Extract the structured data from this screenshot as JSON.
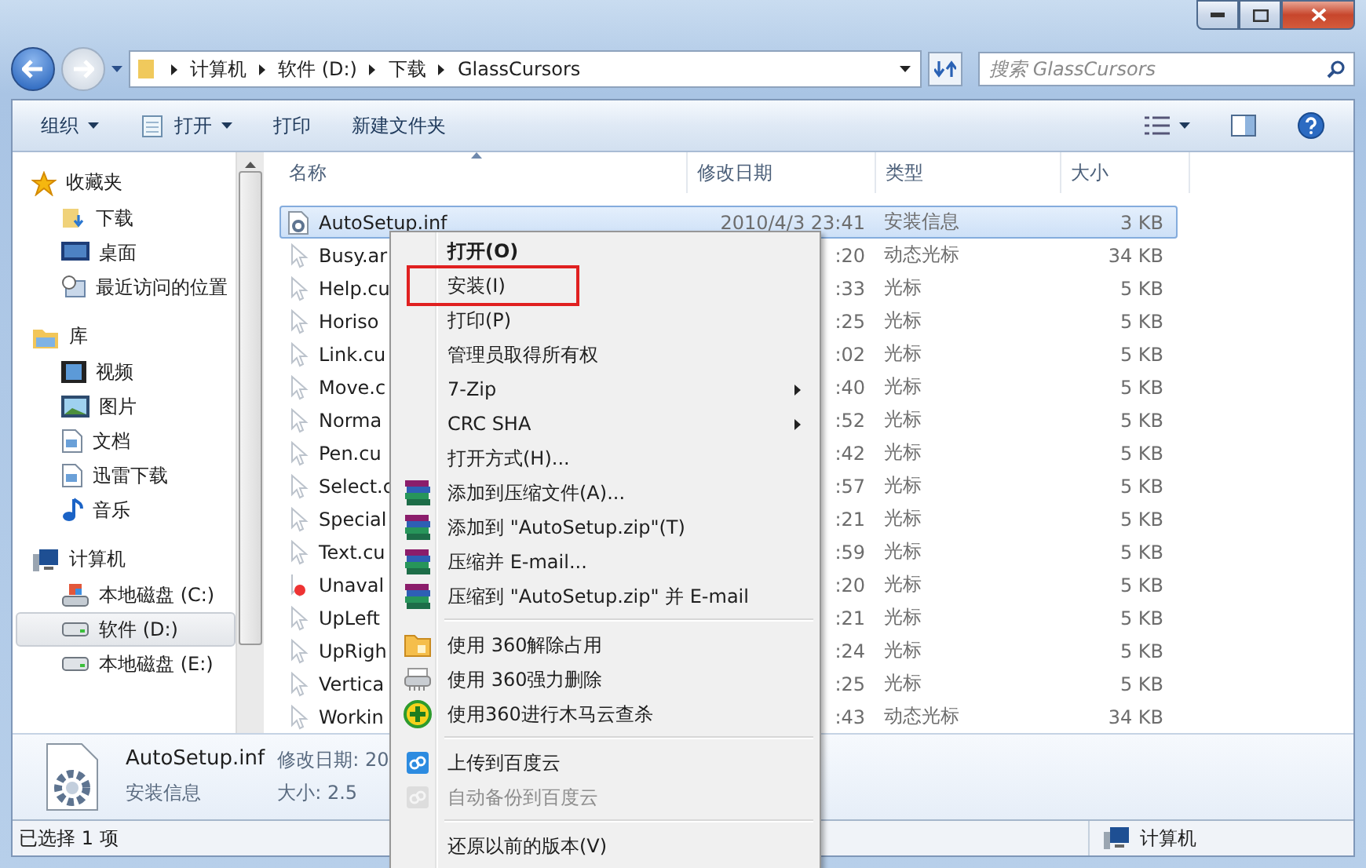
{
  "nav": {
    "path": [
      "计算机",
      "软件 (D:)",
      "下载",
      "GlassCursors"
    ],
    "search": {
      "placeholder": "搜索 GlassCursors"
    }
  },
  "toolbar": {
    "buttons": [
      {
        "label": "组织",
        "kind": "plain",
        "dropdown": true
      },
      {
        "label": "打开",
        "kind": "notepad",
        "dropdown": true
      },
      {
        "label": "打印",
        "kind": "plain",
        "dropdown": false
      },
      {
        "label": "新建文件夹",
        "kind": "plain",
        "dropdown": false
      }
    ]
  },
  "sidebar": {
    "groups": [
      {
        "label": "收藏夹",
        "kind": "star",
        "items": [
          {
            "label": "下载",
            "kind": "download",
            "selected": false
          },
          {
            "label": "桌面",
            "kind": "desktop",
            "selected": false
          },
          {
            "label": "最近访问的位置",
            "kind": "recent",
            "selected": false
          }
        ]
      },
      {
        "label": "库",
        "kind": "library",
        "items": [
          {
            "label": "视频",
            "kind": "video",
            "selected": false
          },
          {
            "label": "图片",
            "kind": "image",
            "selected": false
          },
          {
            "label": "文档",
            "kind": "document",
            "selected": false
          },
          {
            "label": "迅雷下载",
            "kind": "document",
            "selected": false
          },
          {
            "label": "音乐",
            "kind": "music",
            "selected": false
          }
        ]
      },
      {
        "label": "计算机",
        "kind": "computer",
        "items": [
          {
            "label": "本地磁盘 (C:)",
            "kind": "systemdrive",
            "selected": false
          },
          {
            "label": "软件 (D:)",
            "kind": "drive",
            "selected": true
          },
          {
            "label": "本地磁盘 (E:)",
            "kind": "drive",
            "selected": false
          }
        ]
      }
    ]
  },
  "table": {
    "columns": [
      "名称",
      "修改日期",
      "类型",
      "大小"
    ],
    "rows": [
      {
        "name": "AutoSetup.inf",
        "date": "2010/4/3 23:41",
        "type": "安装信息",
        "size": "3 KB",
        "kind": "inf",
        "selected": true
      },
      {
        "name": "Busy.ar",
        "date": ":20",
        "type": "动态光标",
        "size": "34 KB",
        "kind": "cursor",
        "selected": false
      },
      {
        "name": "Help.cu",
        "date": ":33",
        "type": "光标",
        "size": "5 KB",
        "kind": "cursor",
        "selected": false
      },
      {
        "name": "Horiso",
        "date": ":25",
        "type": "光标",
        "size": "5 KB",
        "kind": "cursor",
        "selected": false
      },
      {
        "name": "Link.cu",
        "date": ":02",
        "type": "光标",
        "size": "5 KB",
        "kind": "cursor",
        "selected": false
      },
      {
        "name": "Move.c",
        "date": ":40",
        "type": "光标",
        "size": "5 KB",
        "kind": "cursor",
        "selected": false
      },
      {
        "name": "Norma",
        "date": ":52",
        "type": "光标",
        "size": "5 KB",
        "kind": "cursor",
        "selected": false
      },
      {
        "name": "Pen.cu",
        "date": ":42",
        "type": "光标",
        "size": "5 KB",
        "kind": "cursor",
        "selected": false
      },
      {
        "name": "Select.c",
        "date": ":57",
        "type": "光标",
        "size": "5 KB",
        "kind": "cursor",
        "selected": false
      },
      {
        "name": "Special",
        "date": ":21",
        "type": "光标",
        "size": "5 KB",
        "kind": "cursor",
        "selected": false
      },
      {
        "name": "Text.cu",
        "date": ":59",
        "type": "光标",
        "size": "5 KB",
        "kind": "cursor",
        "selected": false
      },
      {
        "name": "Unaval",
        "date": ":20",
        "type": "光标",
        "size": "5 KB",
        "kind": "blocked",
        "selected": false
      },
      {
        "name": "UpLeft",
        "date": ":21",
        "type": "光标",
        "size": "5 KB",
        "kind": "cursor",
        "selected": false
      },
      {
        "name": "UpRigh",
        "date": ":24",
        "type": "光标",
        "size": "5 KB",
        "kind": "cursor",
        "selected": false
      },
      {
        "name": "Vertica",
        "date": ":25",
        "type": "光标",
        "size": "5 KB",
        "kind": "cursor",
        "selected": false
      },
      {
        "name": "Workin",
        "date": ":43",
        "type": "动态光标",
        "size": "34 KB",
        "kind": "cursor",
        "selected": false
      }
    ]
  },
  "details": {
    "name": "AutoSetup.inf",
    "type": "安装信息",
    "date": "修改日期: 20",
    "size": "大小: 2.5"
  },
  "status_bar": {
    "text": "已选择 1 项",
    "location": "计算机"
  },
  "context_menu": {
    "items": [
      {
        "kind": "plain",
        "label": "打开(O)",
        "default": true,
        "highlighted": false,
        "disabled": false,
        "submenu": false
      },
      {
        "kind": "plain",
        "label": "安装(I)",
        "default": false,
        "highlighted": true,
        "disabled": false,
        "submenu": false
      },
      {
        "kind": "plain",
        "label": "打印(P)",
        "default": false,
        "highlighted": false,
        "disabled": false,
        "submenu": false
      },
      {
        "kind": "plain",
        "label": "管理员取得所有权",
        "default": false,
        "highlighted": false,
        "disabled": false,
        "submenu": false
      },
      {
        "kind": "plain",
        "label": "7-Zip",
        "default": false,
        "highlighted": false,
        "disabled": false,
        "submenu": true
      },
      {
        "kind": "plain",
        "label": "CRC SHA",
        "default": false,
        "highlighted": false,
        "disabled": false,
        "submenu": true
      },
      {
        "kind": "plain",
        "label": "打开方式(H)...",
        "default": false,
        "highlighted": false,
        "disabled": false,
        "submenu": false
      },
      {
        "kind": "archive",
        "label": "添加到压缩文件(A)...",
        "default": false,
        "highlighted": false,
        "disabled": false,
        "submenu": false
      },
      {
        "kind": "archive",
        "label": "添加到 \"AutoSetup.zip\"(T)",
        "default": false,
        "highlighted": false,
        "disabled": false,
        "submenu": false
      },
      {
        "kind": "archive",
        "label": "压缩并 E-mail...",
        "default": false,
        "highlighted": false,
        "disabled": false,
        "submenu": false
      },
      {
        "kind": "archive",
        "label": "压缩到 \"AutoSetup.zip\" 并 E-mail",
        "default": false,
        "highlighted": false,
        "disabled": false,
        "submenu": false
      },
      {
        "kind": "separator"
      },
      {
        "kind": "folder",
        "label": "使用 360解除占用",
        "default": false,
        "highlighted": false,
        "disabled": false,
        "submenu": false
      },
      {
        "kind": "shredder",
        "label": "使用 360强力删除",
        "default": false,
        "highlighted": false,
        "disabled": false,
        "submenu": false
      },
      {
        "kind": "scan",
        "label": "使用360进行木马云查杀",
        "default": false,
        "highlighted": false,
        "disabled": false,
        "submenu": false
      },
      {
        "kind": "separator"
      },
      {
        "kind": "cloud",
        "label": "上传到百度云",
        "default": false,
        "highlighted": false,
        "disabled": false,
        "submenu": false
      },
      {
        "kind": "cloud",
        "label": "自动备份到百度云",
        "default": false,
        "highlighted": false,
        "disabled": true,
        "submenu": false
      },
      {
        "kind": "separator"
      },
      {
        "kind": "plain",
        "label": "还原以前的版本(V)",
        "default": false,
        "highlighted": false,
        "disabled": false,
        "submenu": false
      }
    ]
  }
}
